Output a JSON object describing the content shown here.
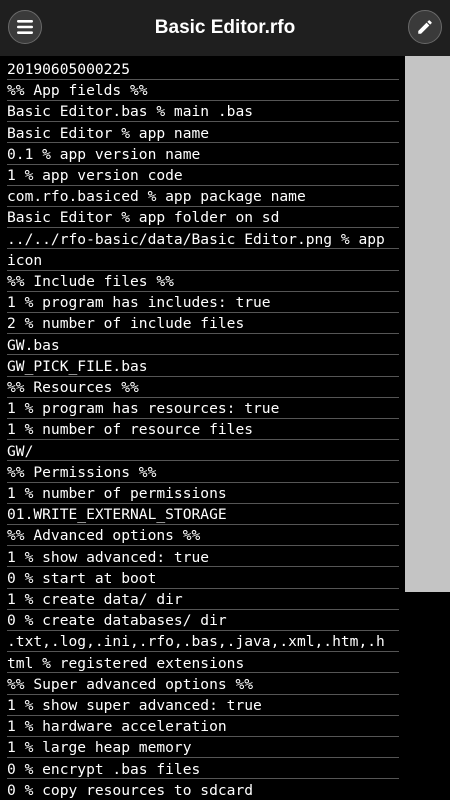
{
  "app_bar": {
    "title": "Basic Editor.rfo",
    "menu_icon": "hamburger-menu-icon",
    "edit_icon": "pencil-icon"
  },
  "editor": {
    "lines": [
      "20190605000225",
      "%% App fields %%",
      "Basic Editor.bas % main .bas",
      "Basic Editor % app name",
      "0.1 % app version name",
      "1 % app version code",
      "com.rfo.basiced % app package name",
      "Basic Editor % app folder on sd",
      "../../rfo-basic/data/Basic Editor.png % app",
      "icon",
      "%% Include files %%",
      "1 % program has includes: true",
      "2 % number of include files",
      "GW.bas",
      "GW_PICK_FILE.bas",
      "%% Resources %%",
      "1 % program has resources: true",
      "1 % number of resource files",
      "GW/",
      "%% Permissions %%",
      "1 % number of permissions",
      "01.WRITE_EXTERNAL_STORAGE",
      "%% Advanced options %%",
      "1 % show advanced: true",
      "0 % start at boot",
      "1 % create data/ dir",
      "0 % create databases/ dir",
      ".txt,.log,.ini,.rfo,.bas,.java,.xml,.htm,.h",
      "tml % registered extensions",
      "%% Super advanced options %%",
      "1 % show super advanced: true",
      "1 % hardware acceleration",
      "1 % large heap memory",
      "0 % encrypt .bas files",
      "0 % copy resources to sdcard"
    ]
  },
  "scrollbar": {
    "position_fraction": 0.0,
    "visible_fraction": 0.72
  },
  "colors": {
    "app_bar": "#1f1f1f",
    "editor_bg": "#000000",
    "text": "#ffffff",
    "rule": "#555555",
    "scrollbar_thumb": "#c4c4c4"
  }
}
